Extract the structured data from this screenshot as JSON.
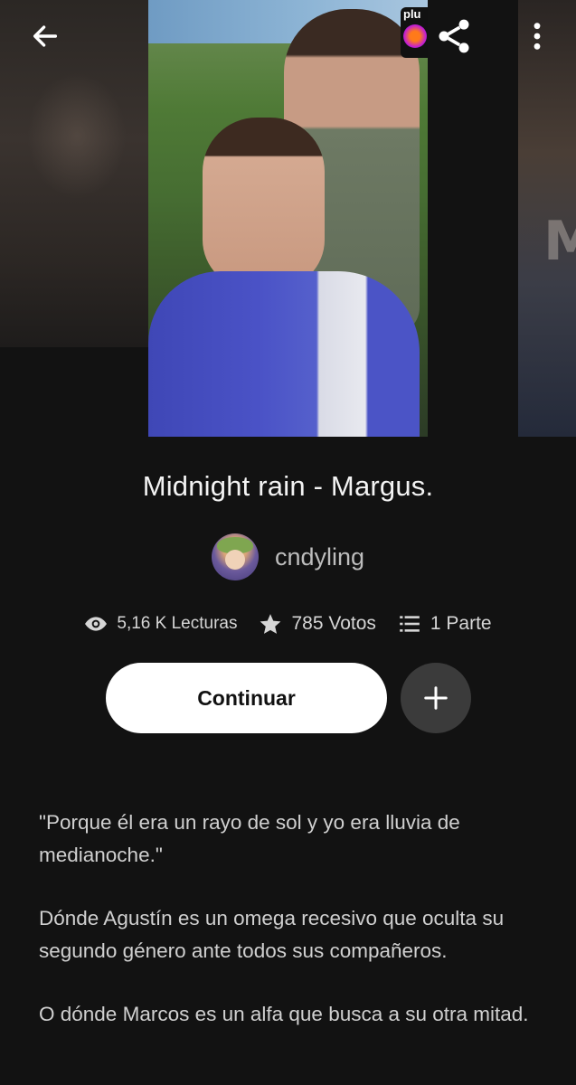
{
  "header": {
    "back_icon": "arrow-left-icon",
    "share_icon": "share-icon",
    "more_icon": "more-vertical-icon",
    "cover_badge_text": "plu"
  },
  "story": {
    "title": "Midnight rain - Margus.",
    "author": "cndyling",
    "stats": {
      "reads": "5,16 K Lecturas",
      "votes": "785 Votos",
      "parts": "1 Parte"
    },
    "continue_label": "Continuar",
    "add_icon": "plus-icon",
    "description": [
      "\"Porque él era un rayo de sol y yo era lluvia de medianoche.\"",
      "Dónde Agustín es un omega recesivo que oculta su segundo género ante todos sus compañeros.",
      "O dónde Marcos es un alfa que busca a su otra mitad."
    ]
  },
  "side_cover_letter": "M",
  "colors": {
    "background": "#121212",
    "button_bg": "#ffffff",
    "add_button_bg": "#3b3b3b",
    "text_secondary": "#bdbdbd"
  }
}
